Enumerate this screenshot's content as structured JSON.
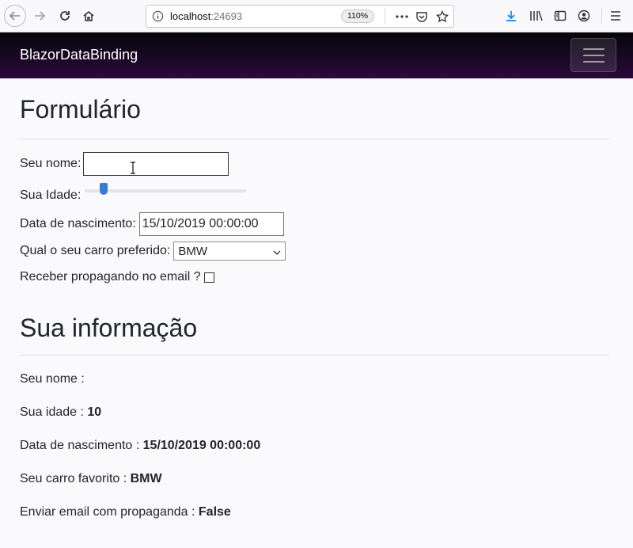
{
  "browser": {
    "url_host": "localhost",
    "url_port": ":24693",
    "zoom": "110%"
  },
  "app": {
    "brand": "BlazorDataBinding"
  },
  "form": {
    "title": "Formulário",
    "name_label": "Seu nome:",
    "name_value": "",
    "age_label": "Sua Idade:",
    "age_value": 10,
    "birth_label": "Data de nascimento:",
    "birth_value": "15/10/2019 00:00:00",
    "car_label": "Qual o seu carro preferido:",
    "car_value": "BMW",
    "email_label": "Receber propagando no email ?",
    "email_checked": false
  },
  "info": {
    "title": "Sua informação",
    "name_label": "Seu nome :",
    "name_value": "",
    "age_label": "Sua idade :",
    "age_value": "10",
    "birth_label": "Data de nascimento :",
    "birth_value": "15/10/2019 00:00:00",
    "car_label": "Seu carro favorito :",
    "car_value": "BMW",
    "email_label": "Enviar email com propaganda :",
    "email_value": "False"
  },
  "colors": {
    "navbar_top": "#05050a",
    "navbar_bottom": "#2a0a3a",
    "slider_thumb": "#3a7bd5",
    "download_icon": "#0a84ff"
  }
}
